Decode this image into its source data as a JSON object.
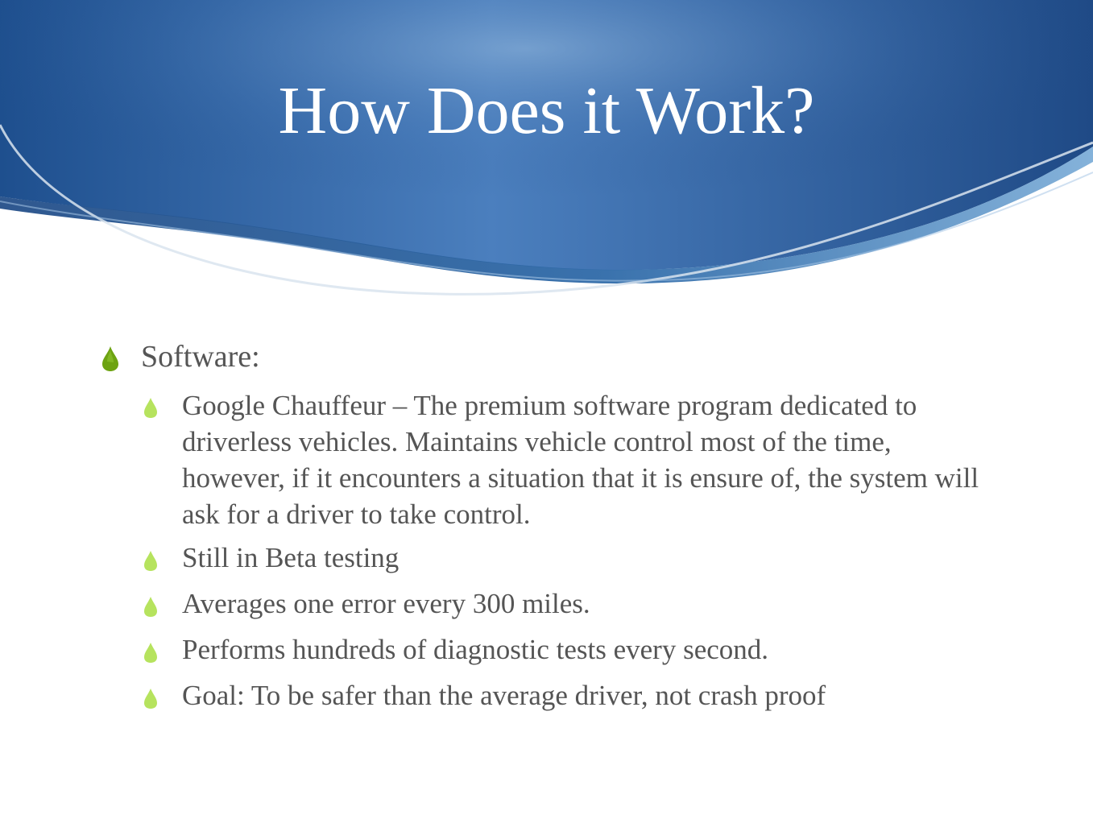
{
  "slide": {
    "title": "How Does it Work?",
    "bullets": [
      {
        "text": "Software:",
        "icon": "leaf-drop-icon",
        "children": [
          "Google Chauffeur – The premium software program dedicated to driverless vehicles.  Maintains vehicle control most of the time, however, if it encounters a situation that it is ensure of, the system will ask for a driver to take control.",
          "Still in Beta testing",
          "Averages one error every 300 miles.",
          "Performs hundreds of diagnostic tests every second.",
          "Goal: To be safer than the average driver, not crash proof"
        ]
      }
    ]
  },
  "colors": {
    "title": "#ffffff",
    "body_text": "#555555",
    "header_dark": "#1f4f8c",
    "header_light": "#4f86c3",
    "bullet_level_1": "#6da312",
    "bullet_level_2": "#b6e35e"
  }
}
